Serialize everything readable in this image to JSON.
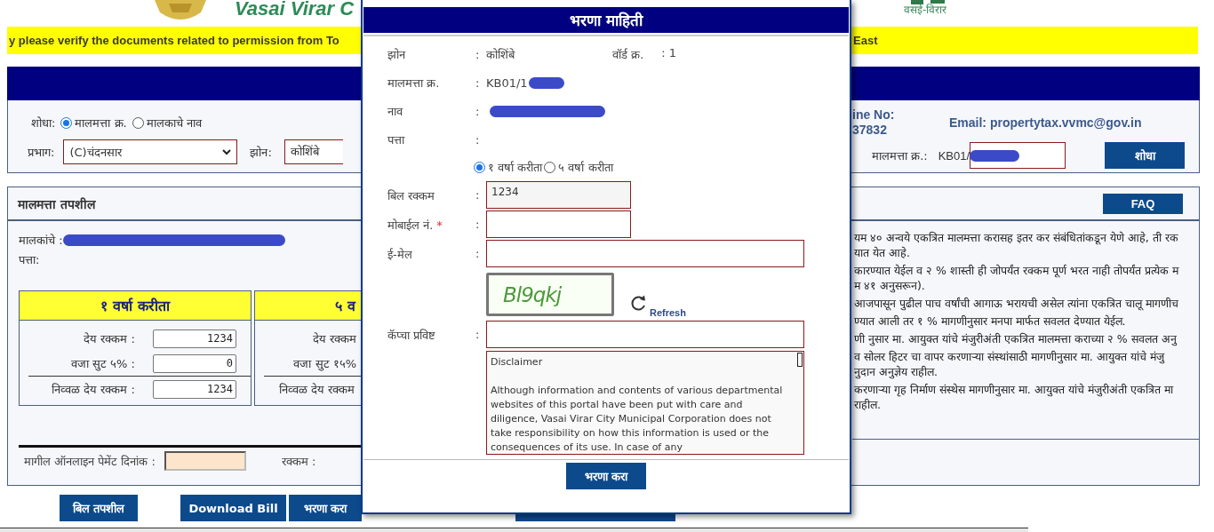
{
  "header": {
    "title": "Vasai Virar C",
    "subtitle": "वसई-विरार"
  },
  "notice": {
    "left": "y please verify the documents related to permission from To",
    "right": "East"
  },
  "search": {
    "label": "शोधा:",
    "options": [
      {
        "label": "मालमत्ता क्र.",
        "selected": true
      },
      {
        "label": "मालकाचे नाव",
        "selected": false
      }
    ],
    "ward_label": "प्रभाग:",
    "ward_value": "(C)चंदनसार",
    "zone_label": "झोन:",
    "zone_value": "कोशिंबे",
    "helpline": [
      "ine No:",
      "37832"
    ],
    "email": "Email: propertytax.vvmc@gov.in",
    "property_label": "मालमत्ता क्र.:",
    "property_prefix": "KB01/",
    "property_redacted": true,
    "button": "शोधा"
  },
  "details": {
    "title": "मालमत्ता तपशील",
    "faq": "FAQ",
    "owner_label": "मालकांचे :",
    "owner_redacted": true,
    "address_label": "पत्ता:",
    "plans": [
      {
        "title": "१ वर्षा करीता",
        "rows": [
          {
            "label": "देय रक्कम :",
            "value": "1234"
          },
          {
            "label": "वजा सुट ५% :",
            "value": "0"
          },
          {
            "label": "निव्वळ देय रक्कम :",
            "value": "1234"
          }
        ]
      },
      {
        "title": "५ व",
        "rows": [
          {
            "label": "देय रक्कम"
          },
          {
            "label": "वजा सुट १५%"
          },
          {
            "label": "निव्वळ देय रक्कम"
          }
        ]
      }
    ],
    "notes": [
      {
        "lines": [
          "यम ४० अन्वये एकत्रित मालमत्ता करासह इतर कर संबंधितांकडून येणे आहे, ती रक",
          "यात येत आहे."
        ]
      },
      {
        "lines": [
          "कारण्यात येईल व २ % शास्ती ही जोपर्यंत रक्कम पूर्ण भरत नाही तोपर्यंत प्रत्येक म",
          "म ४१ अनुसरून)."
        ]
      },
      {
        "lines": [
          "आजपासून पुढील पाच वर्षांची आगाऊ भरायची असेल त्यांना एकत्रित चालू मागणीच"
        ]
      },
      {
        "lines": [
          "ण्यात आली तर १ % मागणीनुसार मनपा मार्फत सवलत देण्यात येईल."
        ]
      },
      {
        "lines": [
          "णी नुसार मा. आयुक्त यांचे मंजुरीअंती एकत्रित मालमत्ता कराच्या २ % सवलत अनु"
        ]
      },
      {
        "lines": [
          "व सोलर हिटर चा वापर करणाऱ्या संस्थांसाठी मागणीनुसार मा. आयुक्त यांचे मंजु",
          "नुदान अनुज्ञेय राहील."
        ]
      },
      {
        "lines": [
          "करणाऱ्या गृह निर्माण संस्थेस मागणीनुसार मा. आयुक्त यांचे मंजुरीअंती एकत्रित मा",
          "राहील."
        ]
      }
    ],
    "last_payment_label": "मागील ऑनलाइन पेमेंट दिनांक :",
    "amount_label": "रक्कम :"
  },
  "buttons": [
    {
      "label": "बिल तपशील"
    },
    {
      "label": "Download Bill"
    },
    {
      "label": "भरणा करा"
    }
  ],
  "payment_dialog": {
    "title": "भरणा माहिती",
    "separator": ":",
    "info_rows": [
      {
        "label": "झोन",
        "value": "कोशिंबे",
        "extra_label": "वॉर्ड क्र.",
        "extra_value": "1"
      },
      {
        "label": "मालमत्ता क्र.",
        "value": "KB01/1",
        "redacted": true
      },
      {
        "label": "नाव",
        "redacted": true
      },
      {
        "label": "पत्ता"
      }
    ],
    "plan_options": [
      {
        "label": "१ वर्षा करीता",
        "selected": true
      },
      {
        "label": "५ वर्षा करीता",
        "selected": false
      }
    ],
    "required_mark": "*",
    "inputs": [
      {
        "label": "बिल रक्कम",
        "value": "1234",
        "kind": "short",
        "readonly": true
      },
      {
        "label": "मोबाईल नं.",
        "kind": "short",
        "required": true
      },
      {
        "label": "ई-मेल",
        "kind": "long"
      }
    ],
    "captcha": {
      "text": "Bl9qkj",
      "refresh": "Refresh"
    },
    "captcha_input": {
      "label": "कॅप्चा प्रविष्ट"
    },
    "disclaimer": "Disclaimer\n\nAlthough information and contents of various departmental websites of this portal have been put with care and diligence, Vasai Virar City Municipal Corporation does not take responsibility on how this information is used or the consequences of its use. In case of any",
    "submit": "भरणा करा"
  }
}
